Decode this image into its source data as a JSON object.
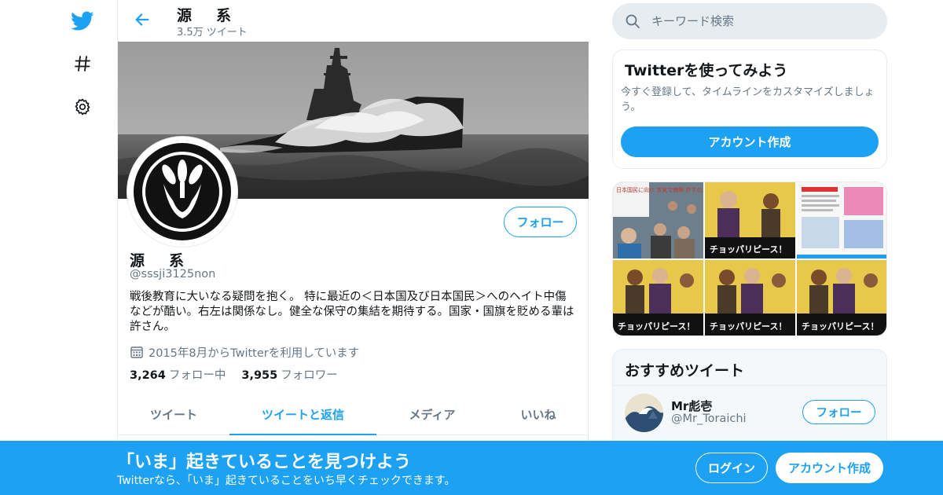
{
  "nav": {
    "twitter_icon": "twitter-bird-icon",
    "explore_icon": "hashtag-icon",
    "settings_icon": "gear-icon"
  },
  "header": {
    "back_icon": "arrow-left-icon",
    "name": "源　系",
    "tweet_count": "3.5万 ツイート"
  },
  "profile": {
    "name": "源　系",
    "handle": "@sssji3125non",
    "bio": "戦後教育に大いなる疑問を抱く。 特に最近の＜日本国及び日本国民＞へのヘイト中傷などが酷い。右左は関係なし。健全な保守の集結を期待する。国家・国旗を貶める輩は許さん。",
    "joined": "2015年8月からTwitterを利用しています",
    "following_count": "3,264",
    "following_label": "フォロー中",
    "followers_count": "3,955",
    "followers_label": "フォロワー",
    "follow_button": "フォロー"
  },
  "tabs": [
    {
      "label": "ツイート",
      "active": false
    },
    {
      "label": "ツイートと返信",
      "active": true
    },
    {
      "label": "メディア",
      "active": false
    },
    {
      "label": "いいね",
      "active": false
    }
  ],
  "search": {
    "placeholder": "キーワード検索",
    "icon": "search-icon"
  },
  "signup_card": {
    "title": "Twitterを使ってみよう",
    "description": "今すぐ登録して、タイムラインをカスタマイズしましょう。",
    "button": "アカウント作成"
  },
  "media": {
    "thumb_captions": [
      "日本国民に向け 本気で侮辱 許すのか！",
      "チョッパリピース！",
      "",
      "チョッパリピース！",
      "チョッパリピース！",
      "チョッパリピース！"
    ]
  },
  "recommended": {
    "title": "おすすめツイート",
    "user_name": "Mr彪壱",
    "user_handle": "@Mr_Toraichi",
    "follow_button": "フォロー"
  },
  "bottom_bar": {
    "title": "「いま」起きていることを見つけよう",
    "subtitle": "Twitterなら、「いま」起きていることをいち早くチェックできます。",
    "login_button": "ログイン",
    "signup_button": "アカウント作成"
  },
  "colors": {
    "brand_blue": "#1da1f2",
    "text_primary": "#14171a",
    "text_secondary": "#657786",
    "border": "#e6ecf0"
  }
}
